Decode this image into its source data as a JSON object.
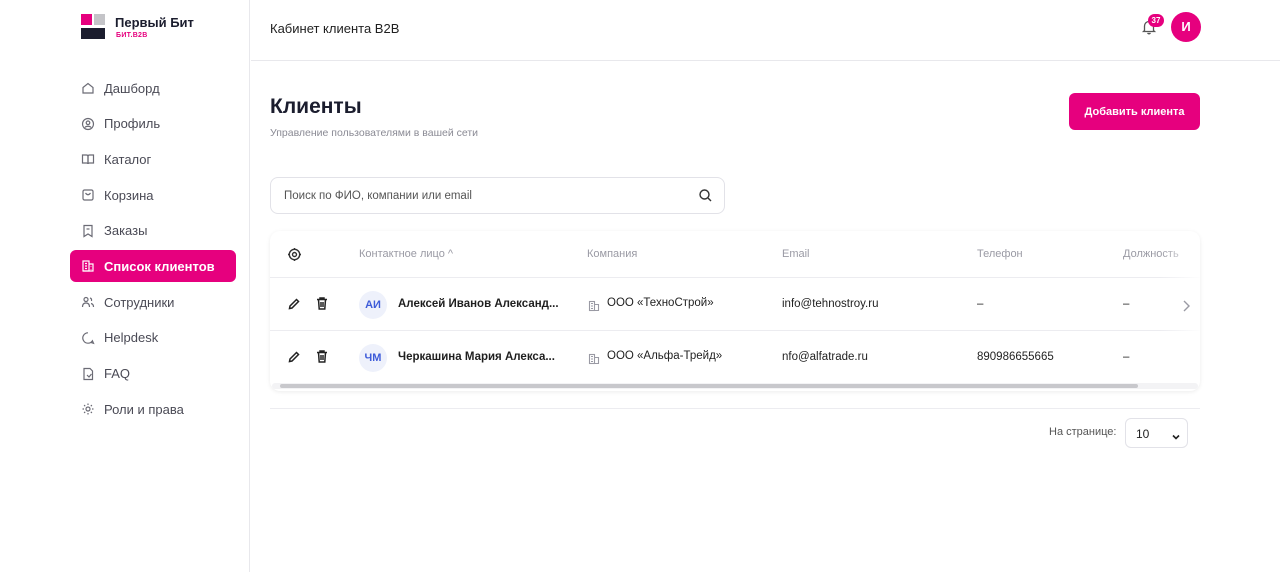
{
  "brand": {
    "name": "Первый Бит",
    "sub": "БИТ.B2B"
  },
  "sidebar": {
    "items": [
      {
        "label": "Дашборд",
        "icon": "home-icon",
        "active": false
      },
      {
        "label": "Профиль",
        "icon": "user-circle-icon",
        "active": false
      },
      {
        "label": "Каталог",
        "icon": "book-icon",
        "active": false
      },
      {
        "label": "Корзина",
        "icon": "cart-icon",
        "active": false
      },
      {
        "label": "Заказы",
        "icon": "receipt-icon",
        "active": false
      },
      {
        "label": "Список клиентов",
        "icon": "building-icon",
        "active": true
      },
      {
        "label": "Сотрудники",
        "icon": "users-icon",
        "active": false
      },
      {
        "label": "Helpdesk",
        "icon": "chat-icon",
        "active": false
      },
      {
        "label": "FAQ",
        "icon": "document-icon",
        "active": false
      },
      {
        "label": "Роли и права",
        "icon": "gear-icon",
        "active": false
      }
    ]
  },
  "header": {
    "title": "Кабинет клиента B2B",
    "notifications_count": "37",
    "avatar_initial": "И"
  },
  "main": {
    "title": "Клиенты",
    "subtitle": "Управление пользователями в вашей сети",
    "add_button": "Добавить клиента",
    "search_placeholder": "Поиск по ФИО, компании или email"
  },
  "table": {
    "columns": [
      "Контактное лицо ^",
      "Компания",
      "Email",
      "Телефон",
      "Должность"
    ],
    "rows": [
      {
        "initials": "АИ",
        "name": "Алексей Иванов Александ...",
        "company": "ООО «ТехноСтрой»",
        "email": "info@tehnostroy.ru",
        "phone": "–",
        "position": "–"
      },
      {
        "initials": "ЧМ",
        "name": "Черкашина Мария Алекса...",
        "company": "ООО «Альфа-Трейд»",
        "email": "nfo@alfatrade.ru",
        "phone": "890986655665",
        "position": "–"
      }
    ]
  },
  "pagination": {
    "per_page_label": "На странице:",
    "per_page_value": "10"
  },
  "colors": {
    "accent": "#e6007e",
    "initials_bg": "#eef1fb",
    "initials_text": "#3d5bd9"
  }
}
